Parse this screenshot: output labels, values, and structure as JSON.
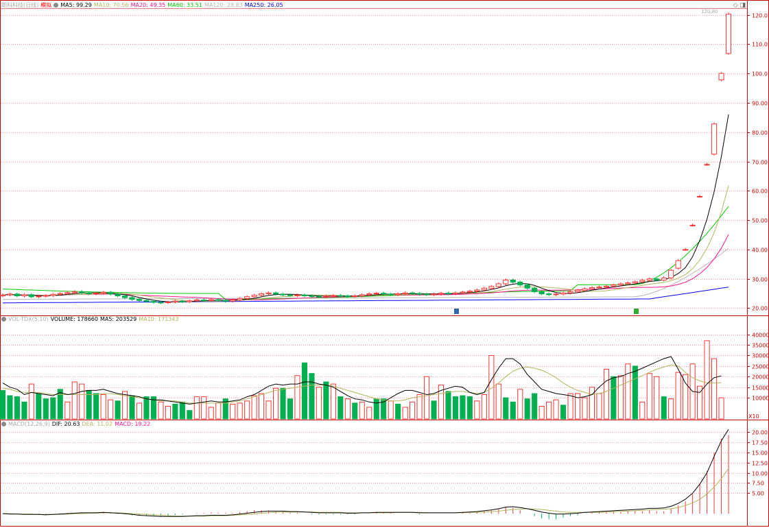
{
  "price_legend": {
    "stock_name": "朗科科技(日线)",
    "mode": "模拟",
    "ma5": "MA5: 99.29",
    "ma10": "MA10: 70.56",
    "ma20": "MA20: 49.35",
    "ma60": "MA60: 33.51",
    "ma120": "MA120: 28.83",
    "ma250": "MA250: 26.05",
    "high_marker": "120.80"
  },
  "vol_legend": {
    "name": "VOL-TDX(5,10)",
    "volume": "VOLUME: 178660",
    "ma5": "MA5: 203529",
    "ma10": "MA10: 171343",
    "unit_badge": "X10"
  },
  "macd_legend": {
    "name": "MACD(12,26,9)",
    "dif": "DIF: 20.63",
    "dea": "DEA: 11.02",
    "macd": "MACD: 19.22"
  },
  "colors": {
    "up": "#ff3333",
    "down": "#00b050",
    "ma5": "#000000",
    "ma10": "#b4b45a",
    "ma20": "#ff1493",
    "ma60": "#00c800",
    "ma120": "#b4b4b4",
    "ma250": "#0000ff",
    "frame": "#cc0000",
    "axis_text": "#cc0000"
  },
  "icons": {
    "diamond": "diamond-icon",
    "window": "window-icon"
  },
  "chart_data": [
    {
      "type": "candlestick",
      "title": "朗科科技(日线)",
      "ylim": [
        18,
        122
      ],
      "y_ticks": [
        "20.00",
        "30.00",
        "40.00",
        "50.00",
        "60.00",
        "70.00",
        "80.00",
        "90.00",
        "100.0",
        "110.0",
        "120.0"
      ],
      "closes": [
        24.5,
        24.8,
        24.2,
        24.6,
        23.9,
        24.1,
        24.3,
        24.7,
        25.0,
        25.3,
        25.6,
        25.2,
        24.9,
        25.1,
        25.4,
        24.8,
        24.2,
        23.6,
        23.0,
        22.6,
        22.3,
        22.0,
        21.9,
        22.1,
        22.4,
        22.2,
        22.5,
        22.8,
        22.6,
        22.9,
        22.7,
        22.4,
        22.8,
        23.3,
        23.9,
        24.4,
        24.9,
        25.2,
        24.8,
        24.5,
        24.3,
        24.5,
        24.2,
        24.0,
        23.9,
        24.1,
        24.3,
        24.2,
        24.0,
        24.2,
        24.6,
        24.9,
        25.1,
        24.8,
        24.6,
        24.9,
        25.2,
        25.0,
        24.8,
        24.6,
        24.8,
        25.1,
        24.9,
        25.2,
        25.5,
        25.8,
        26.2,
        26.8,
        27.4,
        28.3,
        29.6,
        28.9,
        27.9,
        26.8,
        25.6,
        24.9,
        24.6,
        24.8,
        25.2,
        25.6,
        26.1,
        26.6,
        27.0,
        27.2,
        27.5,
        27.9,
        28.3,
        28.6,
        29.0,
        29.5,
        30.0,
        29.6,
        30.3,
        32.9,
        36.2,
        40.0,
        48.3,
        58.1,
        69.0,
        82.8,
        100.0,
        120.2
      ],
      "opens": [
        24.2,
        24.5,
        24.8,
        24.2,
        24.6,
        23.9,
        24.1,
        24.3,
        24.7,
        25.0,
        25.3,
        25.6,
        25.2,
        24.9,
        25.1,
        25.4,
        24.8,
        24.2,
        23.6,
        23.0,
        22.6,
        22.3,
        22.0,
        21.9,
        22.1,
        22.4,
        22.2,
        22.5,
        22.8,
        22.6,
        22.9,
        22.7,
        22.4,
        22.8,
        23.3,
        23.9,
        24.4,
        24.9,
        25.2,
        24.8,
        24.5,
        24.3,
        24.5,
        24.2,
        24.0,
        23.9,
        24.1,
        24.3,
        24.2,
        24.0,
        24.2,
        24.6,
        24.9,
        25.1,
        24.8,
        24.6,
        24.9,
        25.2,
        25.0,
        24.8,
        24.6,
        24.8,
        25.1,
        24.9,
        25.2,
        25.5,
        25.8,
        26.2,
        26.8,
        27.4,
        28.3,
        29.6,
        28.9,
        27.9,
        26.8,
        25.6,
        24.9,
        24.6,
        24.8,
        25.2,
        25.6,
        26.1,
        26.6,
        27.0,
        27.2,
        27.5,
        27.9,
        28.3,
        28.6,
        29.0,
        29.5,
        30.0,
        29.6,
        30.3,
        33.6,
        40.0,
        48.3,
        58.1,
        69.0,
        72.5,
        97.8,
        106.8
      ],
      "annotation_high": "120.80"
    },
    {
      "type": "bar",
      "title": "VOL-TDX(5,10)",
      "ylim": [
        0,
        47000
      ],
      "y_ticks": [
        "10000",
        "15000",
        "20000",
        "25000",
        "30000",
        "35000",
        "40000"
      ],
      "values": [
        13500,
        11000,
        10500,
        8000,
        16500,
        12000,
        9500,
        10000,
        14000,
        8000,
        17500,
        16500,
        13500,
        12000,
        11500,
        9000,
        8500,
        13000,
        11000,
        7500,
        10500,
        10500,
        8000,
        6000,
        7000,
        8000,
        4000,
        10500,
        10500,
        5500,
        7500,
        9500,
        7000,
        7500,
        8500,
        11000,
        12000,
        8500,
        14500,
        14500,
        9500,
        20500,
        26500,
        21500,
        15000,
        17500,
        16500,
        10500,
        9500,
        7500,
        8000,
        5500,
        9500,
        9500,
        8500,
        7000,
        5500,
        8000,
        11500,
        20000,
        8500,
        16000,
        13000,
        10500,
        11000,
        10500,
        8500,
        11500,
        30000,
        16500,
        10000,
        8000,
        14000,
        9500,
        12000,
        6000,
        8000,
        9000,
        6500,
        12000,
        12000,
        10000,
        15000,
        12000,
        23500,
        20000,
        20500,
        26000,
        25000,
        8000,
        21500,
        20000,
        10500,
        9500,
        22000,
        21000,
        26000,
        15500,
        37000,
        28500,
        10000
      ],
      "up": [
        false,
        false,
        false,
        false,
        true,
        false,
        false,
        false,
        false,
        true,
        true,
        true,
        false,
        false,
        true,
        true,
        false,
        true,
        false,
        true,
        false,
        false,
        true,
        true,
        false,
        false,
        false,
        true,
        true,
        true,
        true,
        false,
        true,
        true,
        true,
        true,
        true,
        true,
        true,
        false,
        false,
        true,
        false,
        false,
        true,
        false,
        true,
        false,
        true,
        false,
        true,
        true,
        false,
        false,
        true,
        false,
        true,
        true,
        true,
        true,
        false,
        true,
        false,
        false,
        false,
        false,
        true,
        true,
        true,
        true,
        false,
        false,
        true,
        false,
        false,
        true,
        true,
        true,
        false,
        true,
        true,
        true,
        true,
        true,
        true,
        false,
        true,
        true,
        false,
        true,
        true,
        true,
        false,
        true,
        true,
        true,
        true,
        true,
        true,
        true,
        true
      ],
      "ma5": [
        17000,
        15000,
        14000,
        11500,
        12500,
        12000,
        11500,
        11000,
        12500,
        11500,
        12000,
        13000,
        13500,
        13500,
        14000,
        13000,
        12000,
        11500,
        11000,
        10500,
        9500,
        9000,
        9000,
        8500,
        8000,
        7500,
        7000,
        7500,
        8000,
        8500,
        8000,
        8000,
        8500,
        9000,
        10500,
        11500,
        13500,
        15500,
        16500,
        16000,
        16500,
        16500,
        17500,
        17500,
        16500,
        16000,
        15000,
        13000,
        11000,
        9500,
        9000,
        8000,
        7500,
        8000,
        10000,
        12000,
        13500,
        13500,
        12500,
        11500,
        12000,
        13500,
        14500,
        15500,
        15000,
        12500,
        11500,
        12500,
        18500,
        24000,
        28500,
        28500,
        26000,
        21000,
        17500,
        14000,
        13000,
        12000,
        11500,
        11000,
        10000,
        10500,
        11500,
        15000,
        18000,
        19500,
        20000,
        21500,
        22500,
        24000,
        25500,
        27000,
        28500,
        29500,
        23500,
        17000,
        13000,
        12500,
        16500,
        19500,
        20353
      ],
      "ma10": [
        14500,
        14000,
        13000,
        12500,
        12500,
        12500,
        12000,
        11500,
        11500,
        11500,
        11500,
        11500,
        11500,
        11500,
        12000,
        12000,
        11500,
        11000,
        10500,
        10000,
        9500,
        9000,
        8500,
        8500,
        8500,
        8000,
        7500,
        7500,
        7500,
        7500,
        7500,
        7500,
        8000,
        8500,
        9500,
        10500,
        11500,
        12500,
        13500,
        14000,
        14500,
        15000,
        15500,
        16000,
        16000,
        16000,
        15500,
        14500,
        13500,
        12500,
        11500,
        10500,
        9500,
        9000,
        8500,
        8500,
        9000,
        10000,
        10500,
        11000,
        11500,
        12000,
        12500,
        13000,
        13000,
        12500,
        12000,
        12500,
        14500,
        17000,
        20000,
        22500,
        24000,
        24500,
        24000,
        23000,
        21500,
        19500,
        17000,
        15000,
        13500,
        12500,
        11500,
        12000,
        13000,
        14500,
        16000,
        17500,
        19000,
        20500,
        22000,
        23500,
        24500,
        25500,
        25000,
        22000,
        19500,
        18000,
        17000,
        17000,
        17134
      ]
    },
    {
      "type": "line",
      "title": "MACD(12,26,9)",
      "ylim": [
        -2.5,
        22
      ],
      "y_ticks": [
        "5.00",
        "7.50",
        "10.00",
        "12.50",
        "15.00",
        "17.50",
        "20.00"
      ],
      "dif": [
        0.0,
        -0.1,
        -0.1,
        -0.2,
        -0.2,
        -0.2,
        -0.3,
        -0.2,
        -0.1,
        0.0,
        0.1,
        0.2,
        0.2,
        0.2,
        0.3,
        0.2,
        0.1,
        0.0,
        -0.2,
        -0.4,
        -0.5,
        -0.6,
        -0.7,
        -0.7,
        -0.7,
        -0.7,
        -0.6,
        -0.5,
        -0.5,
        -0.4,
        -0.4,
        -0.4,
        -0.3,
        -0.1,
        0.1,
        0.3,
        0.5,
        0.6,
        0.6,
        0.6,
        0.5,
        0.5,
        0.4,
        0.3,
        0.2,
        0.2,
        0.2,
        0.2,
        0.1,
        0.1,
        0.2,
        0.2,
        0.3,
        0.3,
        0.3,
        0.3,
        0.3,
        0.3,
        0.2,
        0.2,
        0.2,
        0.2,
        0.2,
        0.2,
        0.3,
        0.4,
        0.5,
        0.7,
        0.9,
        1.2,
        1.6,
        1.7,
        1.5,
        1.2,
        0.8,
        0.4,
        0.1,
        -0.1,
        -0.1,
        0.0,
        0.1,
        0.3,
        0.4,
        0.5,
        0.6,
        0.7,
        0.8,
        0.9,
        1.0,
        1.1,
        1.3,
        1.3,
        1.4,
        1.8,
        2.5,
        3.5,
        5.0,
        7.2,
        10.0,
        14.0,
        17.8,
        20.63
      ],
      "dea": [
        0.0,
        0.0,
        -0.1,
        -0.1,
        -0.1,
        -0.2,
        -0.2,
        -0.2,
        -0.2,
        -0.1,
        0.0,
        0.0,
        0.1,
        0.1,
        0.2,
        0.2,
        0.2,
        0.1,
        0.0,
        -0.1,
        -0.2,
        -0.3,
        -0.4,
        -0.5,
        -0.6,
        -0.6,
        -0.6,
        -0.6,
        -0.6,
        -0.5,
        -0.5,
        -0.5,
        -0.4,
        -0.3,
        -0.2,
        -0.1,
        0.1,
        0.2,
        0.3,
        0.4,
        0.4,
        0.4,
        0.4,
        0.4,
        0.3,
        0.3,
        0.3,
        0.3,
        0.2,
        0.2,
        0.2,
        0.2,
        0.2,
        0.2,
        0.2,
        0.3,
        0.3,
        0.3,
        0.3,
        0.2,
        0.2,
        0.2,
        0.2,
        0.2,
        0.2,
        0.3,
        0.3,
        0.4,
        0.5,
        0.6,
        0.8,
        1.0,
        1.1,
        1.2,
        1.1,
        1.0,
        0.8,
        0.6,
        0.4,
        0.3,
        0.3,
        0.3,
        0.3,
        0.3,
        0.4,
        0.5,
        0.6,
        0.6,
        0.7,
        0.8,
        0.9,
        1.0,
        1.1,
        1.2,
        1.5,
        2.0,
        2.6,
        3.5,
        4.8,
        6.5,
        8.6,
        11.02
      ],
      "macd": [
        0.0,
        -0.1,
        -0.1,
        -0.2,
        -0.2,
        -0.1,
        -0.2,
        0.0,
        0.1,
        0.2,
        0.2,
        0.3,
        0.3,
        0.2,
        0.2,
        0.1,
        -0.1,
        -0.2,
        -0.4,
        -0.5,
        -0.6,
        -0.6,
        -0.6,
        -0.5,
        -0.3,
        -0.2,
        0.0,
        0.1,
        0.2,
        0.3,
        0.2,
        0.2,
        0.2,
        0.4,
        0.6,
        0.8,
        0.8,
        0.8,
        0.6,
        0.4,
        0.2,
        0.2,
        0.0,
        -0.2,
        -0.2,
        -0.2,
        -0.2,
        -0.2,
        -0.2,
        -0.2,
        0.0,
        0.0,
        0.2,
        0.2,
        0.2,
        0.0,
        0.0,
        0.0,
        -0.2,
        0.0,
        0.0,
        0.0,
        0.0,
        0.0,
        0.2,
        0.2,
        0.4,
        0.6,
        0.8,
        1.2,
        1.6,
        1.4,
        0.8,
        0.0,
        -0.6,
        -1.2,
        -1.4,
        -1.4,
        -1.0,
        -0.6,
        -0.4,
        0.0,
        0.2,
        0.4,
        0.4,
        0.4,
        0.4,
        0.6,
        0.6,
        0.6,
        0.8,
        0.6,
        0.6,
        1.2,
        2.0,
        3.0,
        4.8,
        7.4,
        10.4,
        15.0,
        18.4,
        19.22
      ]
    }
  ]
}
